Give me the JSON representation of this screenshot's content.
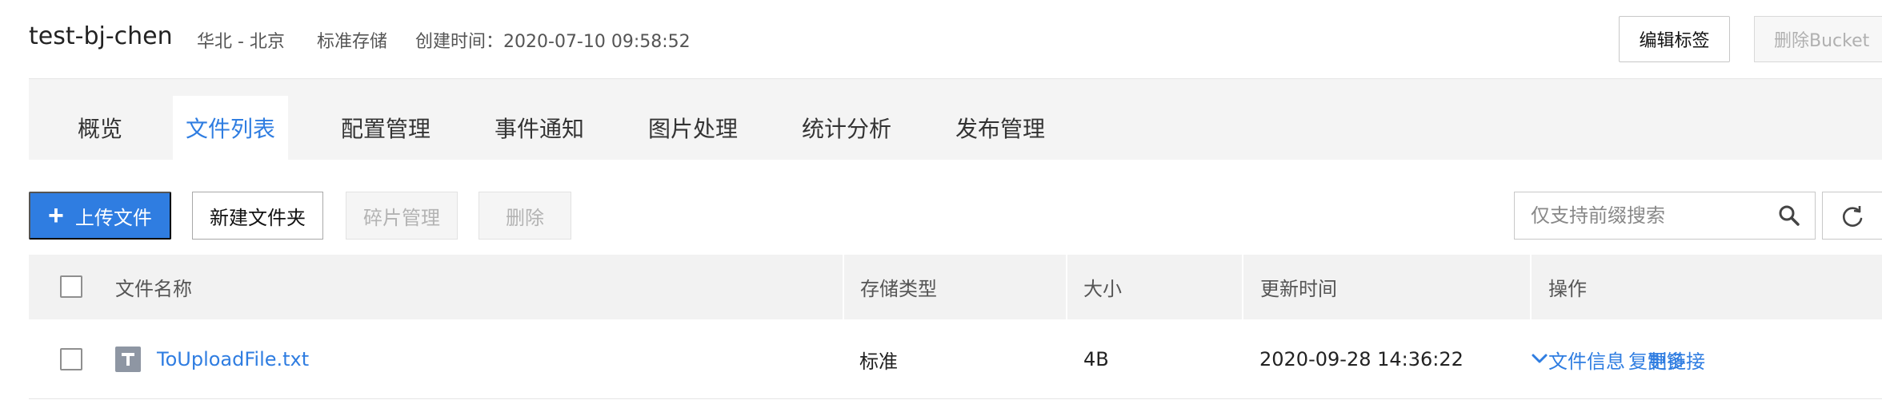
{
  "header": {
    "bucket_name": "test-bj-chen",
    "region": "华北 - 北京",
    "storage_class": "标准存储",
    "created_label": "创建时间：",
    "created_value": "2020-07-10 09:58:52",
    "edit_tags_label": "编辑标签",
    "delete_bucket_label": "删除Bucket"
  },
  "tabs": [
    {
      "label": "概览"
    },
    {
      "label": "文件列表",
      "active": true
    },
    {
      "label": "配置管理"
    },
    {
      "label": "事件通知"
    },
    {
      "label": "图片处理"
    },
    {
      "label": "统计分析"
    },
    {
      "label": "发布管理"
    }
  ],
  "toolbar": {
    "upload_label": "上传文件",
    "new_folder_label": "新建文件夹",
    "fragment_label": "碎片管理",
    "delete_label": "删除",
    "search_placeholder": "仅支持前缀搜索"
  },
  "table": {
    "columns": [
      "文件名称",
      "存储类型",
      "大小",
      "更新时间",
      "操作"
    ],
    "rows": [
      {
        "name": "ToUploadFile.txt",
        "storage": "标准",
        "size": "4B",
        "updated": "2020-09-28 14:36:22",
        "actions": {
          "info": "文件信息",
          "copy_link": "复制链接",
          "more": "更多"
        }
      }
    ]
  },
  "colors": {
    "accent": "#2f7de1",
    "tab_bg": "#f4f4f4",
    "table_head_bg": "#f2f2f2",
    "disabled_text": "#b3b3b3"
  },
  "icons": [
    "plus-icon",
    "search-icon",
    "refresh-icon",
    "text-file-icon",
    "chevron-down-icon"
  ]
}
